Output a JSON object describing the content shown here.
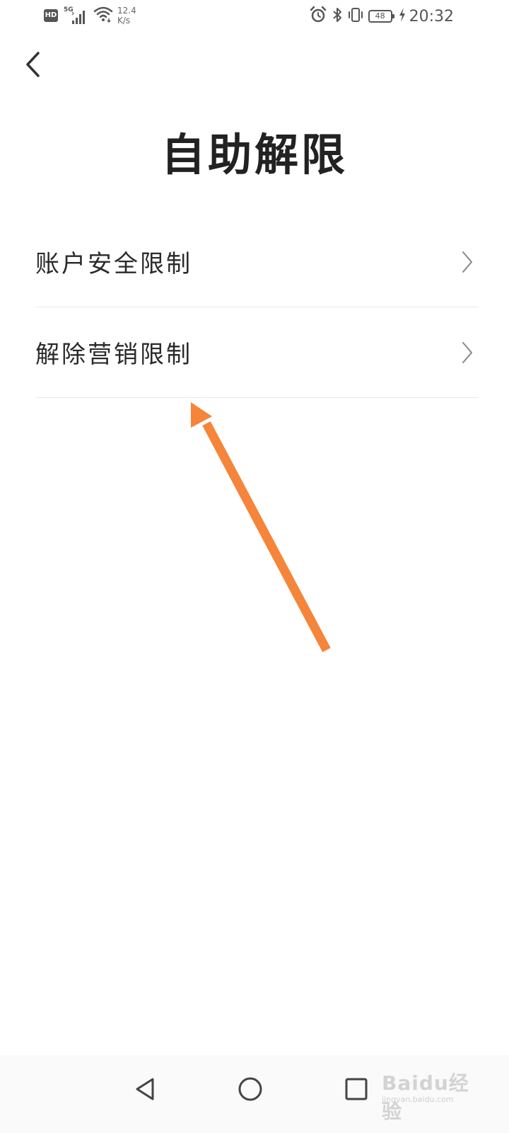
{
  "status_bar": {
    "hd": "HD",
    "network": "5G",
    "speed_value": "12.4",
    "speed_unit": "K/s",
    "battery": "48",
    "time": "20:32"
  },
  "header": {
    "title": "自助解限"
  },
  "menu": {
    "items": [
      {
        "label": "账户安全限制"
      },
      {
        "label": "解除营销限制"
      }
    ]
  },
  "annotation": {
    "arrow_color": "#F5853A"
  },
  "watermark": {
    "main": "Baidu经验",
    "sub": "jingyan.baidu.com"
  },
  "colors": {
    "text_primary": "#222222",
    "divider": "#e9e9e9",
    "icon": "#555555"
  }
}
